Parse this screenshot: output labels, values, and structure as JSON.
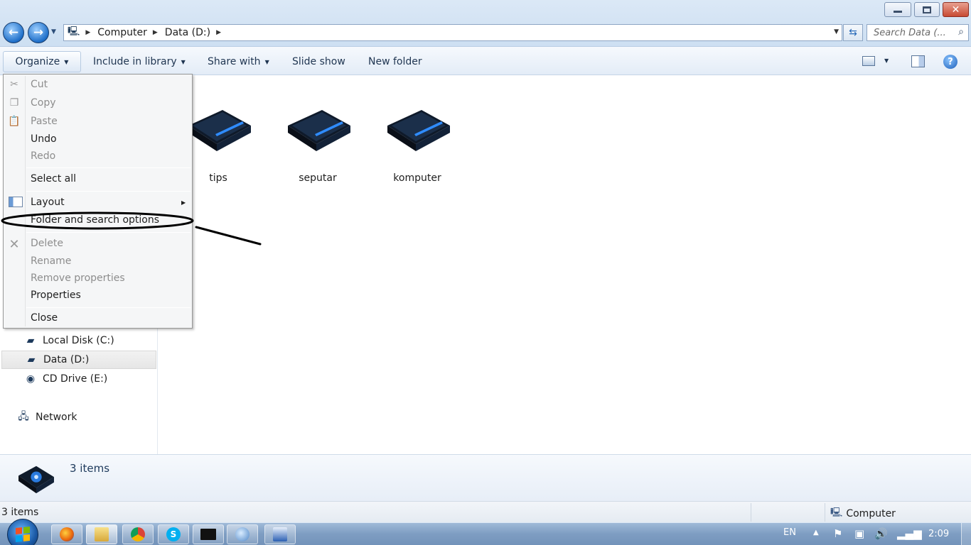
{
  "window": {
    "close_glyph": "✕"
  },
  "address": {
    "segments": [
      "Computer",
      "Data (D:)"
    ],
    "icon": "computer-breadcrumb-icon"
  },
  "search": {
    "placeholder": "Search Data (..."
  },
  "toolbar": {
    "organize": "Organize",
    "include_in_library": "Include in library",
    "share_with": "Share with",
    "slide_show": "Slide show",
    "new_folder": "New folder",
    "help": "?"
  },
  "organize_menu": {
    "items": [
      {
        "label": "Cut",
        "enabled": false,
        "icon": "scissors-icon"
      },
      {
        "label": "Copy",
        "enabled": false,
        "icon": "copy-icon"
      },
      {
        "label": "Paste",
        "enabled": false,
        "icon": "paste-icon"
      },
      {
        "label": "Undo",
        "enabled": true
      },
      {
        "label": "Redo",
        "enabled": false
      },
      {
        "label": "Select all",
        "enabled": true
      },
      {
        "label": "Layout",
        "enabled": true,
        "icon": "layout-icon",
        "submenu": true
      },
      {
        "label": "Folder and search options",
        "enabled": true,
        "highlighted_by_annotation": true
      },
      {
        "label": "Delete",
        "enabled": false,
        "icon": "delete-x-icon"
      },
      {
        "label": "Rename",
        "enabled": false
      },
      {
        "label": "Remove properties",
        "enabled": false
      },
      {
        "label": "Properties",
        "enabled": true
      },
      {
        "label": "Close",
        "enabled": true
      }
    ]
  },
  "navigation": {
    "drives": [
      {
        "label": "Local Disk (C:)",
        "icon": "hard-disk-icon"
      },
      {
        "label": "Data (D:)",
        "icon": "hard-disk-icon",
        "selected": true
      },
      {
        "label": "CD Drive (E:)",
        "icon": "cd-drive-icon"
      }
    ],
    "network": {
      "label": "Network",
      "icon": "network-icon"
    }
  },
  "content": {
    "folders": [
      {
        "label": "tips"
      },
      {
        "label": "seputar"
      },
      {
        "label": "komputer"
      }
    ]
  },
  "details": {
    "count": "3 items"
  },
  "status": {
    "count": "3 items",
    "location": "Computer"
  },
  "taskbar": {
    "apps": [
      "firefox-icon",
      "explorer-icon",
      "chrome-icon",
      "skype-icon",
      "command-prompt-icon",
      "app-icon",
      "word-icon"
    ],
    "tray": {
      "language": "EN",
      "clock": "2:09"
    }
  },
  "colors": {
    "accent": "#1f6fc9",
    "drive_icon_blue": "#2f8cff",
    "annotation": "#000000"
  }
}
